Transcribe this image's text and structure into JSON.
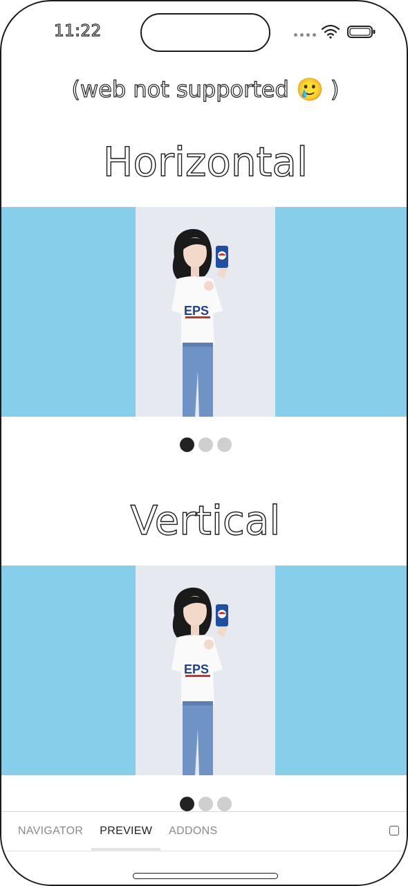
{
  "status_bar": {
    "time": "11:22",
    "icons": [
      "signal-dots-icon",
      "wifi-icon",
      "battery-icon"
    ]
  },
  "main": {
    "notice": "(web not supported 🥲 )",
    "horizontal": {
      "title": "Horizontal",
      "background_color": "#87ceeb",
      "slide_count": 3,
      "active_index": 0
    },
    "vertical": {
      "title": "Vertical",
      "background_color": "#87ceeb",
      "slide_count": 3,
      "active_index": 0
    }
  },
  "panel": {
    "tabs": [
      {
        "label": "NAVIGATOR",
        "active": false
      },
      {
        "label": "PREVIEW",
        "active": true
      },
      {
        "label": "ADDONS",
        "active": false
      }
    ],
    "toggle_icon": "square-icon"
  },
  "colors": {
    "carousel_bg": "#87ceeb",
    "dot_active": "#222222",
    "dot_inactive": "#cfcfcf",
    "photo_bg": "#e6e9ef"
  }
}
